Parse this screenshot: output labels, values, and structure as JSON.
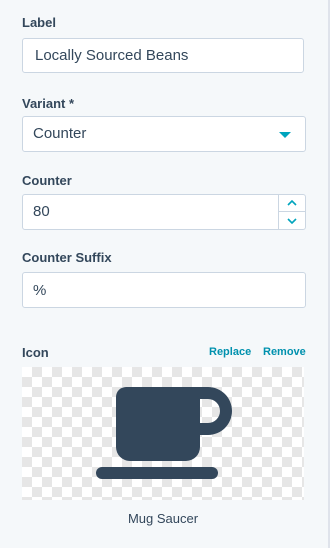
{
  "label_field": {
    "label": "Label",
    "value": "Locally Sourced Beans"
  },
  "variant_field": {
    "label": "Variant *",
    "value": "Counter"
  },
  "counter_field": {
    "label": "Counter",
    "value": "80"
  },
  "suffix_field": {
    "label": "Counter Suffix",
    "value": "%"
  },
  "icon_field": {
    "label": "Icon",
    "replace_label": "Replace",
    "remove_label": "Remove",
    "icon": "mug-saucer-icon",
    "name": "Mug Saucer"
  },
  "colors": {
    "accent": "#00a4bd",
    "link": "#0091ae",
    "text": "#33475b",
    "icon": "#33475b"
  }
}
